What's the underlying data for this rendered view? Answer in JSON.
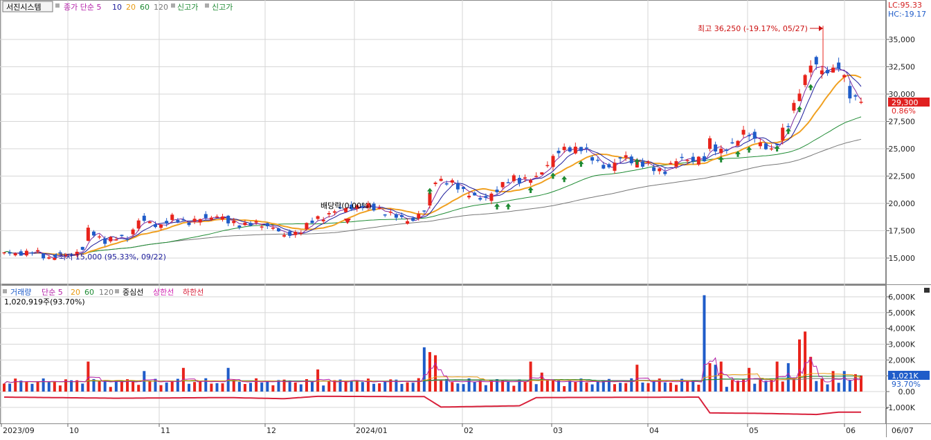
{
  "price_panel": {
    "legend": {
      "title": "서진시스템",
      "ma_label": "종가 단순 5",
      "ma_periods": [
        "10",
        "20",
        "60",
        "120"
      ],
      "new_high_1": "신고가",
      "new_high_2": "신고가"
    },
    "corner": {
      "lc": "LC:95.33",
      "hc": "HC:-19.17"
    },
    "current_price": "29,300",
    "current_change": "0.86%",
    "annotations": {
      "high": "최고 36,250 (-19.17%, 05/27)",
      "low": "최저 15,000 (95.33%, 09/22)",
      "dividend": "배당락(0.00%)"
    },
    "y_ticks": [
      "35,000",
      "32,500",
      "30,000",
      "27,500",
      "25,000",
      "22,500",
      "20,000",
      "17,500",
      "15,000"
    ]
  },
  "volume_panel": {
    "legend": {
      "title": "거래량",
      "ma_label": "단순 5",
      "ma_periods": [
        "20",
        "60",
        "120"
      ],
      "center_line": "중심선",
      "upper_line": "상한선",
      "lower_line": "하한선"
    },
    "current_volume": "1,020,919주(93.70%)",
    "badge_volume": "1,021K",
    "badge_pct": "93.70%",
    "y_ticks": [
      "6,000K",
      "5,000K",
      "4,000K",
      "3,000K",
      "2,000K",
      "1,000K",
      "0.00",
      "-1,000K"
    ]
  },
  "x_labels": [
    "2023/09",
    "10",
    "11",
    "12",
    "2024/01",
    "02",
    "03",
    "04",
    "05",
    "06",
    "06/07"
  ],
  "colors": {
    "up": "#e8231b",
    "down": "#1f5cc9",
    "ma5": "#7d2aa0",
    "ma10": "#1a1a9a",
    "ma20": "#f0a020",
    "ma60": "#1d8a32",
    "ma120": "#777777",
    "new_high_arrow": "#1d8a32"
  },
  "chart_data": {
    "type": "candlestick",
    "title": "서진시스템",
    "period": "2023/09 – 2024/06/07",
    "current": {
      "close": 29300,
      "change_pct": 0.86
    },
    "high": {
      "value": 36250,
      "date": "05/27",
      "pct_from_current": -19.17
    },
    "low": {
      "value": 15000,
      "date": "09/22",
      "pct_from_current": 95.33
    },
    "y_range": [
      13500,
      36800
    ],
    "monthly_approx": [
      {
        "month": "2023/09",
        "open": 15300,
        "high": 15900,
        "low": 15000,
        "close": 15500
      },
      {
        "month": "10",
        "open": 15500,
        "high": 17800,
        "low": 15200,
        "close": 16700
      },
      {
        "month": "11",
        "open": 16700,
        "high": 19200,
        "low": 16600,
        "close": 18400
      },
      {
        "month": "12",
        "open": 18400,
        "high": 19200,
        "low": 16400,
        "close": 17600
      },
      {
        "month": "2024/01",
        "open": 17600,
        "high": 20500,
        "low": 17500,
        "close": 19200
      },
      {
        "month": "02",
        "open": 19200,
        "high": 23000,
        "low": 18200,
        "close": 20300
      },
      {
        "month": "03",
        "open": 20300,
        "high": 25500,
        "low": 20100,
        "close": 25200
      },
      {
        "month": "04",
        "open": 25200,
        "high": 26500,
        "low": 22300,
        "close": 24300
      },
      {
        "month": "05",
        "open": 24300,
        "high": 36250,
        "low": 21900,
        "close": 32000
      },
      {
        "month": "06",
        "open": 32000,
        "high": 33000,
        "low": 28500,
        "close": 29300
      }
    ],
    "volume": {
      "current": 1020919,
      "current_pct": 93.7,
      "peak_k": 6100,
      "y_range_k": [
        -1000,
        6000
      ]
    }
  }
}
